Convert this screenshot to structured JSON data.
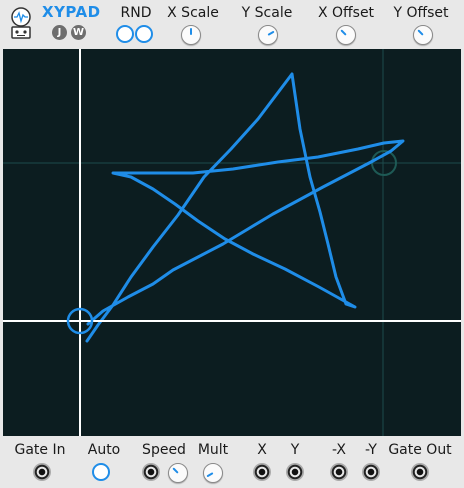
{
  "header": {
    "brand": "XYPAD",
    "badges": [
      "J",
      "W"
    ],
    "labels": {
      "rnd": "RND",
      "x_scale": "X Scale",
      "y_scale": "Y Scale",
      "x_offset": "X Offset",
      "y_offset": "Y Offset"
    }
  },
  "footer": {
    "labels": {
      "gate_in": "Gate In",
      "auto": "Auto",
      "speed": "Speed",
      "mult": "Mult",
      "x": "X",
      "y": "Y",
      "neg_x": "-X",
      "neg_y": "-Y",
      "gate_out": "Gate Out"
    }
  },
  "colors": {
    "accent": "#1f8de8",
    "pad_background": "#0c1d20",
    "crosshair": "#ffffff"
  },
  "icons": {
    "logo": "robot-face-icon",
    "jack": "audio-jack-icon"
  }
}
